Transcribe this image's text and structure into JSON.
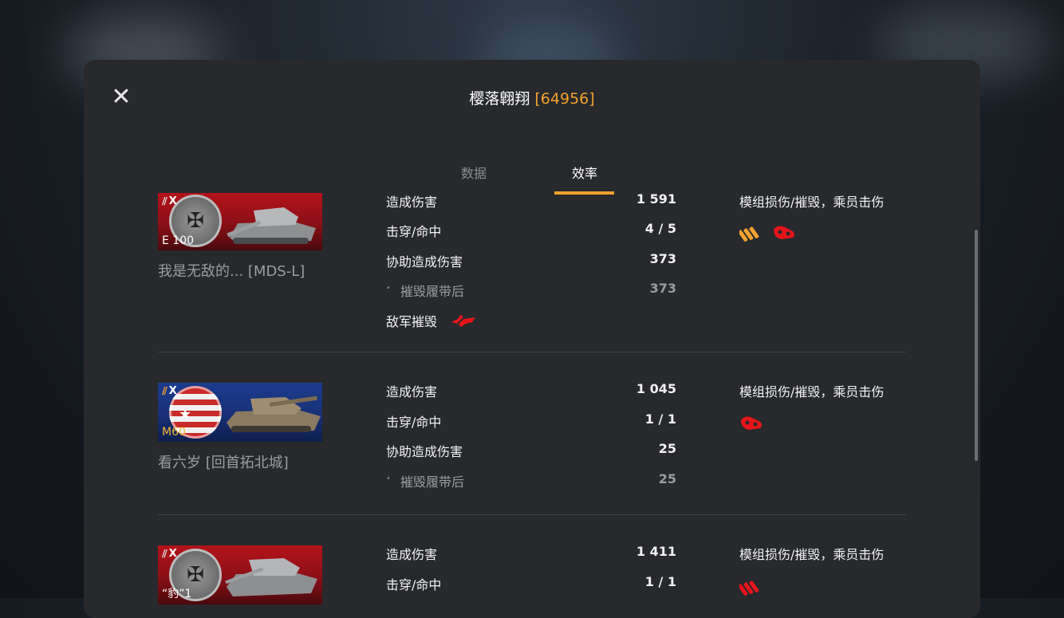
{
  "header": {
    "player_name": "樱落翺翔",
    "player_id": "[64956]",
    "close_symbol": "✕"
  },
  "tabs": [
    {
      "label": "数据",
      "active": false
    },
    {
      "label": "效率",
      "active": true
    }
  ],
  "colors": {
    "accent": "#f2a22e",
    "crit_red": "#e8141b",
    "panel_bg": "#27292c"
  },
  "rows": [
    {
      "tank": {
        "name": "E 100",
        "tier": "X",
        "nation_flag": "germany",
        "name_color": "white"
      },
      "player": "我是无敌的... [MDS-L]",
      "stats": [
        {
          "label": "造成伤害",
          "value": "1 591"
        },
        {
          "label": "击穿/命中",
          "value": "4 / 5"
        },
        {
          "label": "协助造成伤害",
          "value": "373"
        },
        {
          "label": "摧毁履带后",
          "value": "373",
          "sub": true
        }
      ],
      "kill_label": "敌军摧毁",
      "kill_icon": "destroyed-tank-icon",
      "modules_title": "模组损伤/摧毁，乘员击伤",
      "module_icons": [
        "ammo-rack-damaged-icon",
        "track-destroyed-icon"
      ]
    },
    {
      "tank": {
        "name": "M60",
        "tier": "X",
        "nation_flag": "usa",
        "name_color": "gold"
      },
      "player": "看六岁 [回首拓北城]",
      "stats": [
        {
          "label": "造成伤害",
          "value": "1 045"
        },
        {
          "label": "击穿/命中",
          "value": "1 / 1"
        },
        {
          "label": "协助造成伤害",
          "value": "25"
        },
        {
          "label": "摧毁履带后",
          "value": "25",
          "sub": true
        }
      ],
      "modules_title": "模组损伤/摧毁，乘员击伤",
      "module_icons": [
        "track-destroyed-icon"
      ]
    },
    {
      "tank": {
        "name": "“豹”1",
        "tier": "X",
        "nation_flag": "germany",
        "name_color": "white"
      },
      "player": "",
      "stats": [
        {
          "label": "造成伤害",
          "value": "1 411"
        },
        {
          "label": "击穿/命中",
          "value": "1 / 1"
        }
      ],
      "modules_title": "模组损伤/摧毁，乘员击伤",
      "module_icons": [
        "ammo-rack-destroyed-icon"
      ]
    }
  ]
}
